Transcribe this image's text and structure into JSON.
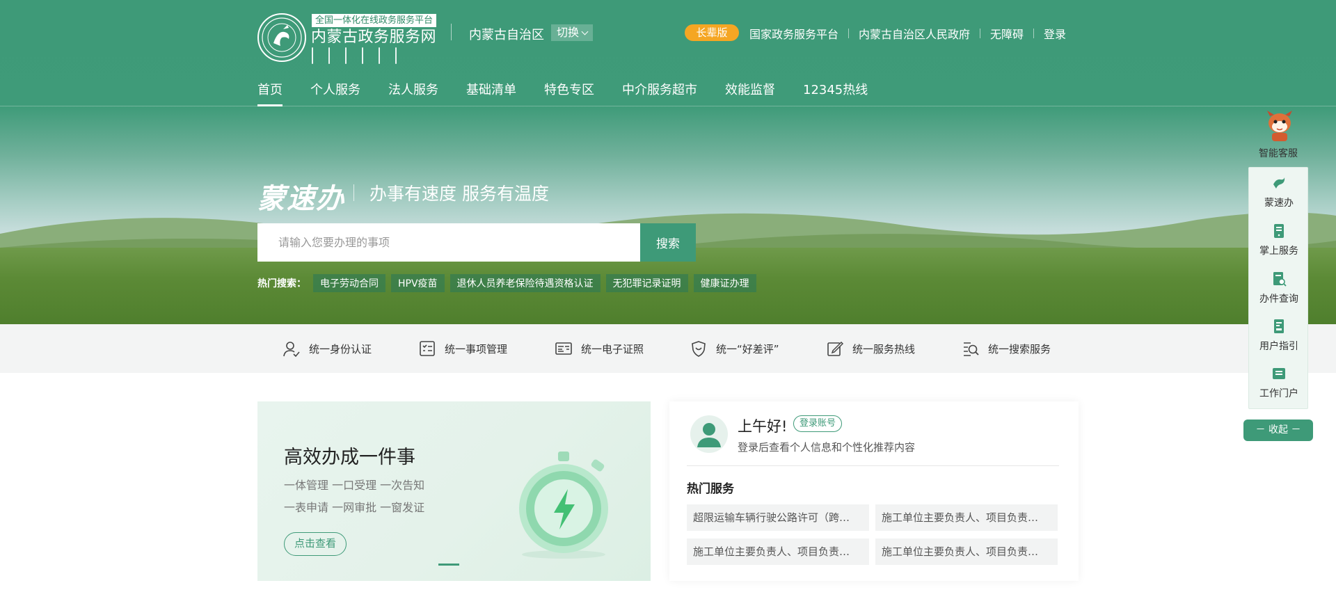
{
  "header": {
    "platform_tag": "全国一体化在线政务服务平台",
    "site_name": "内蒙古政务服务网",
    "region_name": "内蒙古自治区",
    "region_switch_label": "切换",
    "elder_label": "长辈版",
    "top_links": [
      "国家政务服务平台",
      "内蒙古自治区人民政府",
      "无障碍",
      "登录"
    ],
    "nav": [
      "首页",
      "个人服务",
      "法人服务",
      "基础清单",
      "特色专区",
      "中介服务超市",
      "效能监督",
      "12345热线"
    ],
    "active_nav": "首页",
    "brand_color": "#3e9a78"
  },
  "hero": {
    "brand": "蒙速办",
    "slogan": "办事有速度  服务有温度",
    "search_placeholder": "请输入您要办理的事项",
    "search_button": "搜索",
    "hot_label": "热门搜索：",
    "hot_tags": [
      "电子劳动合同",
      "HPV疫苗",
      "退休人员养老保险待遇资格认证",
      "无犯罪记录证明",
      "健康证办理"
    ]
  },
  "services": [
    {
      "label": "统一身份认证",
      "icon": "identity-icon"
    },
    {
      "label": "统一事项管理",
      "icon": "checklist-icon"
    },
    {
      "label": "统一电子证照",
      "icon": "license-card-icon"
    },
    {
      "label": "统一“好差评”",
      "icon": "rating-shield-icon"
    },
    {
      "label": "统一服务热线",
      "icon": "edit-hotline-icon"
    },
    {
      "label": "统一搜索服务",
      "icon": "search-list-icon"
    }
  ],
  "banner": {
    "title": "高效办成一件事",
    "line1": "一体管理  一口受理  一次告知",
    "line2": "一表申请  一网审批  一窗发证",
    "button": "点击查看"
  },
  "user_card": {
    "greeting": "上午好!",
    "login_badge": "登录账号",
    "login_tip": "登录后查看个人信息和个性化推荐内容",
    "hot_title": "热门服务",
    "hot_services": [
      "超限运输车辆行驶公路许可（跨…",
      "施工单位主要负责人、项目负责…",
      "施工单位主要负责人、项目负责…",
      "施工单位主要负责人、项目负责…"
    ]
  },
  "side_panel": {
    "customer_service": "智能客服",
    "items": [
      {
        "label": "蒙速办",
        "icon": "mengsuban-icon"
      },
      {
        "label": "掌上服务",
        "icon": "mobile-service-icon"
      },
      {
        "label": "办件查询",
        "icon": "document-search-icon"
      },
      {
        "label": "用户指引",
        "icon": "user-guide-icon"
      },
      {
        "label": "工作门户",
        "icon": "work-portal-icon"
      }
    ],
    "collapse": "－ 收起 －"
  }
}
